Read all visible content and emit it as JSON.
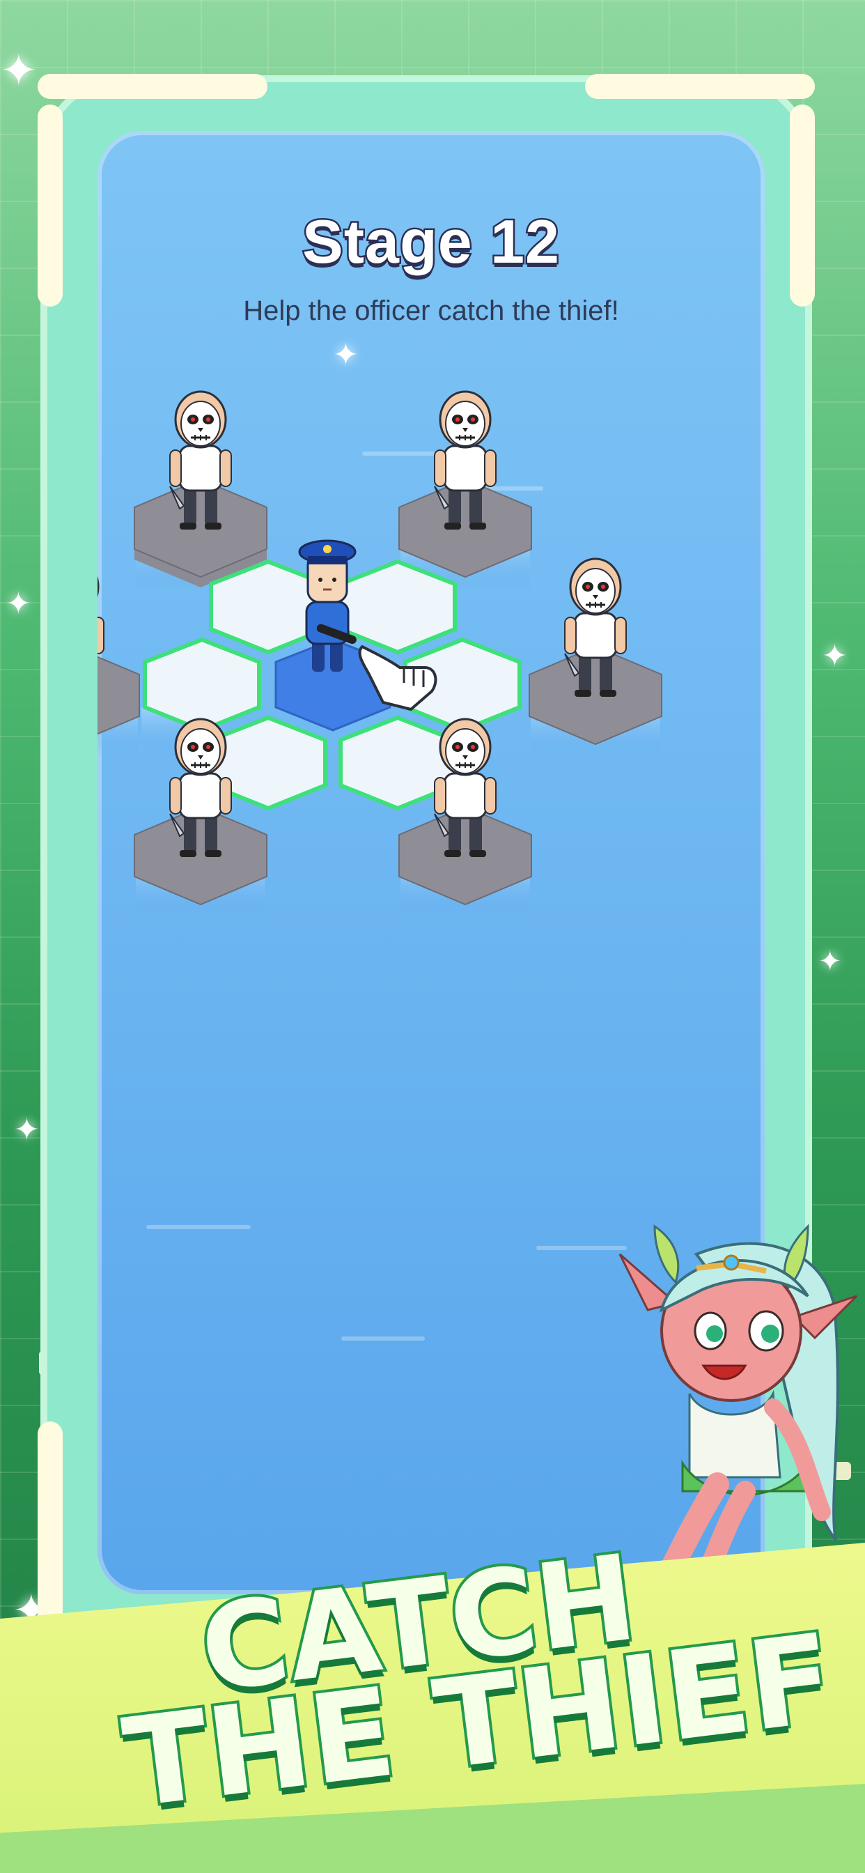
{
  "screen": {
    "stage_title": "Stage 12",
    "stage_subtitle": "Help the officer catch the thief!"
  },
  "banner": {
    "line1": "CATCH",
    "line2": "THE THIEF"
  },
  "board": {
    "player": "police-officer",
    "enemies": [
      "skull-masked-thief",
      "skull-masked-thief",
      "skull-masked-thief",
      "skull-masked-thief",
      "skull-masked-thief",
      "skull-masked-thief"
    ],
    "highlighted_tiles": 6,
    "hint": "tap-hand-icon"
  },
  "colors": {
    "background": "#4cb870",
    "screen": "#6fb8f2",
    "highlight": "#3ee07a",
    "banner": "#e4f680",
    "title_stroke": "#2c2f55"
  }
}
